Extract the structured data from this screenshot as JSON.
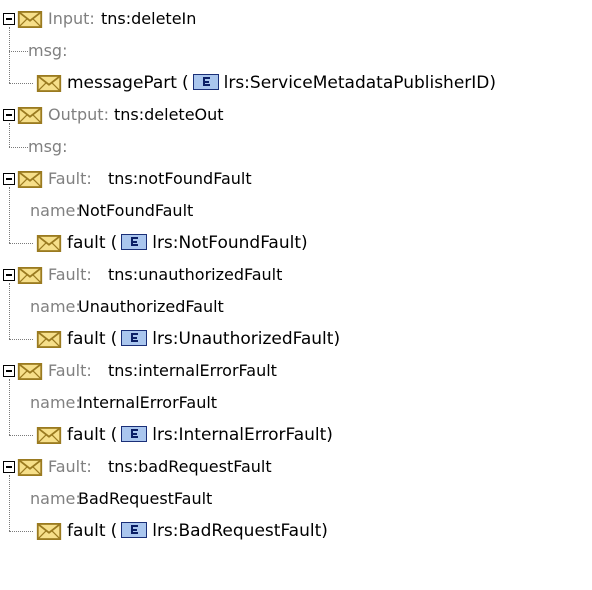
{
  "operation": {
    "input": {
      "label": "Input:",
      "name": "tns:deleteIn",
      "msg_label": "msg:",
      "parts": [
        {
          "name": "messagePart",
          "open": "(",
          "type": "lrs:ServiceMetadataPublisherID",
          "close": ")"
        }
      ]
    },
    "output": {
      "label": "Output:",
      "name": "tns:deleteOut",
      "msg_label": "msg:"
    },
    "faults": [
      {
        "label": "Fault:",
        "qname": "tns:notFoundFault",
        "name_label": "name:",
        "name": "NotFoundFault",
        "part": {
          "name": "fault",
          "open": "(",
          "type": "lrs:NotFoundFault",
          "close": ")"
        }
      },
      {
        "label": "Fault:",
        "qname": "tns:unauthorizedFault",
        "name_label": "name:",
        "name": "UnauthorizedFault",
        "part": {
          "name": "fault",
          "open": "(",
          "type": "lrs:UnauthorizedFault",
          "close": ")"
        }
      },
      {
        "label": "Fault:",
        "qname": "tns:internalErrorFault",
        "name_label": "name:",
        "name": "InternalErrorFault",
        "part": {
          "name": "fault",
          "open": "(",
          "type": "lrs:InternalErrorFault",
          "close": ")"
        }
      },
      {
        "label": "Fault:",
        "qname": "tns:badRequestFault",
        "name_label": "name:",
        "name": "BadRequestFault",
        "part": {
          "name": "fault",
          "open": "(",
          "type": "lrs:BadRequestFault",
          "close": ")"
        }
      }
    ]
  },
  "icons": {
    "toggle": "collapse-minus-icon",
    "message": "envelope-icon",
    "element": "element-type-icon"
  },
  "colors": {
    "label_gray": "#808080",
    "envelope_fill": "#f6df8a",
    "envelope_stroke": "#9a7a20",
    "element_fill": "#aac6ee",
    "element_stroke": "#1a2f78"
  }
}
